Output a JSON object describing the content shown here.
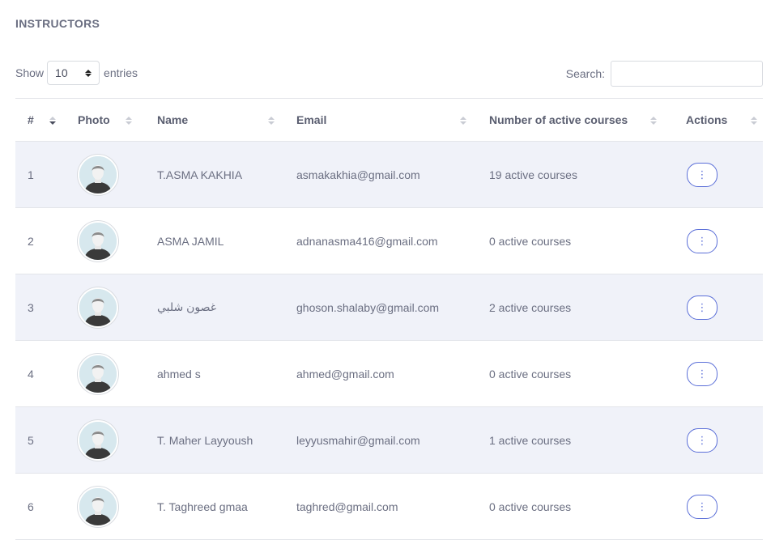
{
  "page": {
    "title": "INSTRUCTORS"
  },
  "length": {
    "show_label": "Show",
    "value": "10",
    "entries_label": "entries"
  },
  "search": {
    "label": "Search:",
    "value": ""
  },
  "table": {
    "headers": [
      "#",
      "Photo",
      "Name",
      "Email",
      "Number of active courses",
      "Actions"
    ],
    "rows": [
      {
        "num": "1",
        "name": "T.ASMA KAKHIA",
        "email": "asmakakhia@gmail.com",
        "courses": "19 active courses"
      },
      {
        "num": "2",
        "name": "ASMA JAMIL",
        "email": "adnanasma416@gmail.com",
        "courses": "0 active courses"
      },
      {
        "num": "3",
        "name": "غصون شلبي",
        "email": "ghoson.shalaby@gmail.com",
        "courses": "2 active courses"
      },
      {
        "num": "4",
        "name": "ahmed s",
        "email": "ahmed@gmail.com",
        "courses": "0 active courses"
      },
      {
        "num": "5",
        "name": "T. Maher Layyoush",
        "email": "leyyusmahir@gmail.com",
        "courses": "1 active courses"
      },
      {
        "num": "6",
        "name": "T. Taghreed gmaa",
        "email": "taghred@gmail.com",
        "courses": "0 active courses"
      }
    ]
  },
  "icons": {
    "action": "more-vertical-icon",
    "avatar": "default-user-avatar",
    "sort": "sort-icon"
  },
  "colors": {
    "accent": "#5b6fd8",
    "row_alt": "#f0f2f9",
    "text": "#6b6f82"
  }
}
